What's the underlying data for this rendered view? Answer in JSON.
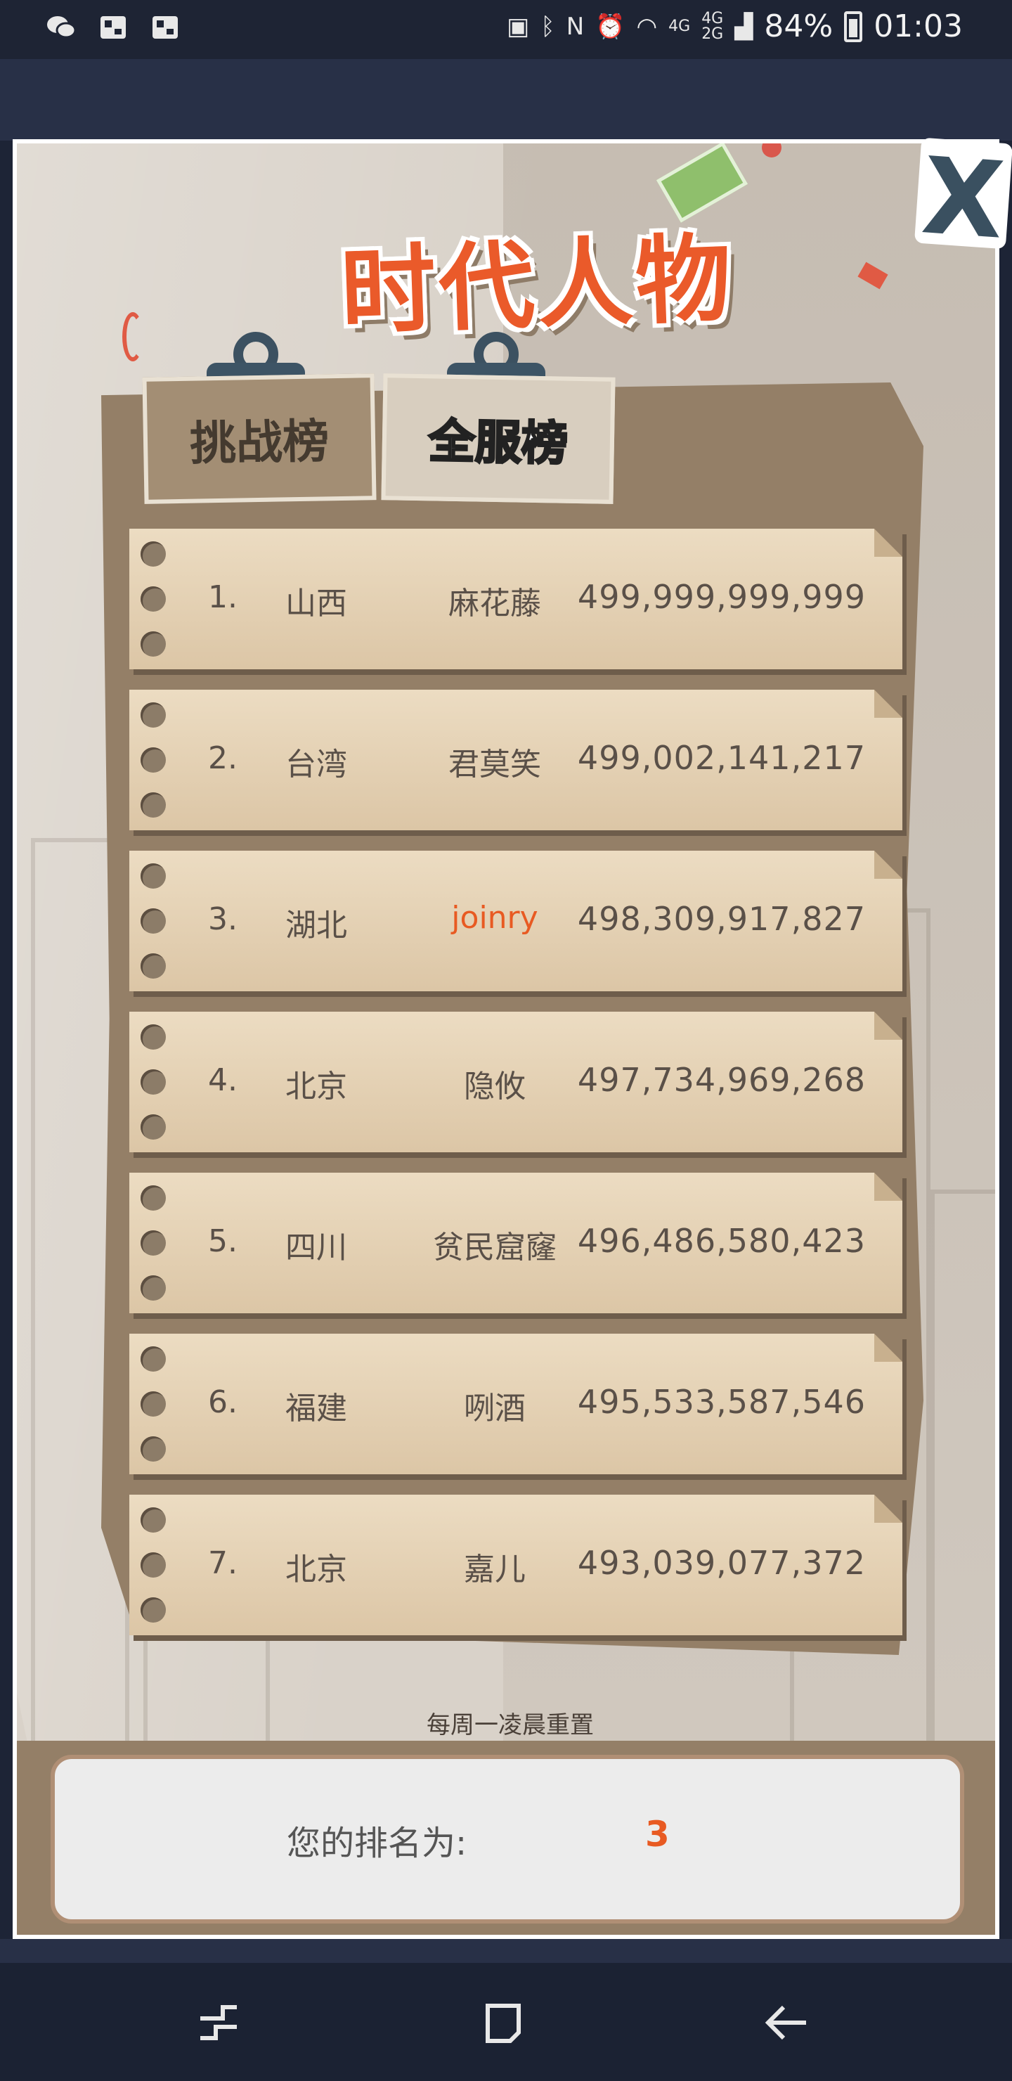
{
  "status_bar": {
    "network": "4G",
    "network2": "4G",
    "network3": "2G",
    "battery": "84%",
    "time": "01:03"
  },
  "game": {
    "title": "时代人物",
    "tabs": [
      {
        "label": "挑战榜"
      },
      {
        "label": "全服榜"
      }
    ],
    "leaderboard": [
      {
        "rank": "1.",
        "province": "山西",
        "name": "麻花藤",
        "score": "499,999,999,999"
      },
      {
        "rank": "2.",
        "province": "台湾",
        "name": "君莫笑",
        "score": "499,002,141,217"
      },
      {
        "rank": "3.",
        "province": "湖北",
        "name": "joinry",
        "score": "498,309,917,827"
      },
      {
        "rank": "4.",
        "province": "北京",
        "name": "隐攸",
        "score": "497,734,969,268"
      },
      {
        "rank": "5.",
        "province": "四川",
        "name": "贫民窟窿",
        "score": "496,486,580,423"
      },
      {
        "rank": "6.",
        "province": "福建",
        "name": "咧酒",
        "score": "495,533,587,546"
      },
      {
        "rank": "7.",
        "province": "北京",
        "name": "嘉儿",
        "score": "493,039,077,372"
      }
    ],
    "reset_note": "每周一凌晨重置",
    "my_rank_label": "您的排名为:",
    "my_rank_value": "3",
    "close_symbol": "X"
  },
  "nav": {
    "recent": "recent-apps-icon",
    "home": "home-icon",
    "back": "back-icon"
  }
}
